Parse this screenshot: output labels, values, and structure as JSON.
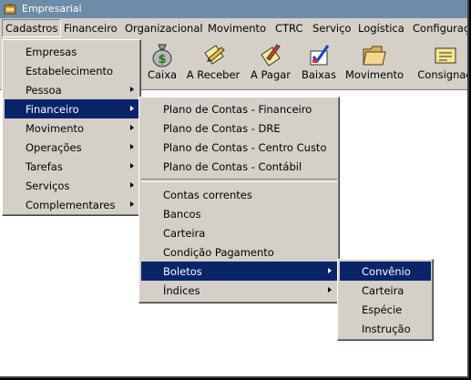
{
  "window": {
    "title": "Empresarial"
  },
  "menubar": [
    {
      "label": "Cadastros",
      "open": true
    },
    {
      "label": "Financeiro"
    },
    {
      "label": "Organizacional"
    },
    {
      "label": "Movimento"
    },
    {
      "label": "CTRC"
    },
    {
      "label": "Serviço"
    },
    {
      "label": "Logística"
    },
    {
      "label": "Configuraç"
    }
  ],
  "toolbar": [
    {
      "label": "Caixa",
      "icon": "money-bag-icon"
    },
    {
      "label": "A Receber",
      "icon": "pencil-document-icon"
    },
    {
      "label": "A Pagar",
      "icon": "write-document-icon"
    },
    {
      "label": "Baixas",
      "icon": "checkmark-form-icon"
    },
    {
      "label": "Movimento",
      "icon": "folder-icon"
    },
    {
      "label": "Consignaç",
      "icon": "note-icon"
    }
  ],
  "cadastros_menu": [
    {
      "label": "Empresas"
    },
    {
      "label": "Estabelecimento"
    },
    {
      "label": "Pessoa",
      "submenu": true
    },
    {
      "label": "Financeiro",
      "submenu": true,
      "selected": true
    },
    {
      "label": "Movimento",
      "submenu": true
    },
    {
      "label": "Operações",
      "submenu": true
    },
    {
      "label": "Tarefas",
      "submenu": true
    },
    {
      "label": "Serviços",
      "submenu": true
    },
    {
      "label": "Complementares",
      "submenu": true
    }
  ],
  "financeiro_menu": [
    {
      "label": "Plano de Contas - Financeiro"
    },
    {
      "label": "Plano de Contas - DRE"
    },
    {
      "label": "Plano de Contas - Centro Custo"
    },
    {
      "label": "Plano de Contas - Contábil"
    },
    {
      "separator": true
    },
    {
      "label": "Contas correntes"
    },
    {
      "label": "Bancos"
    },
    {
      "label": "Carteira"
    },
    {
      "label": "Condição Pagamento"
    },
    {
      "label": "Boletos",
      "submenu": true,
      "selected": true
    },
    {
      "label": "Índices",
      "submenu": true
    }
  ],
  "boletos_menu": [
    {
      "label": "Convênio",
      "selected": true
    },
    {
      "label": "Carteira"
    },
    {
      "label": "Espécie"
    },
    {
      "label": "Instrução"
    }
  ],
  "colors": {
    "titlebar": "#6e8ca8",
    "face": "#d4d0c8",
    "highlight": "#0a246a"
  }
}
